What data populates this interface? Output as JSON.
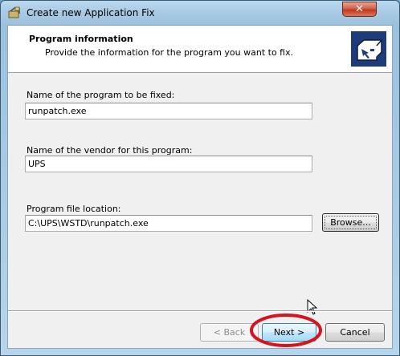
{
  "window": {
    "title": "Create new Application Fix",
    "close_glyph": "✕"
  },
  "header": {
    "title": "Program information",
    "subtitle": "Provide the information for the program you want to fix."
  },
  "form": {
    "program_name": {
      "label": "Name of the program to be fixed:",
      "value": "runpatch.exe"
    },
    "vendor_name": {
      "label": "Name of the vendor for this program:",
      "value": "UPS"
    },
    "file_location": {
      "label": "Program file location:",
      "value": "C:\\UPS\\WSTD\\runpatch.exe"
    },
    "browse_label": "Browse..."
  },
  "footer": {
    "back_label": "< Back",
    "next_label": "Next >",
    "cancel_label": "Cancel"
  },
  "colors": {
    "annotation_ellipse": "#d4141e",
    "wizard_icon_bg": "#1e3c78"
  }
}
